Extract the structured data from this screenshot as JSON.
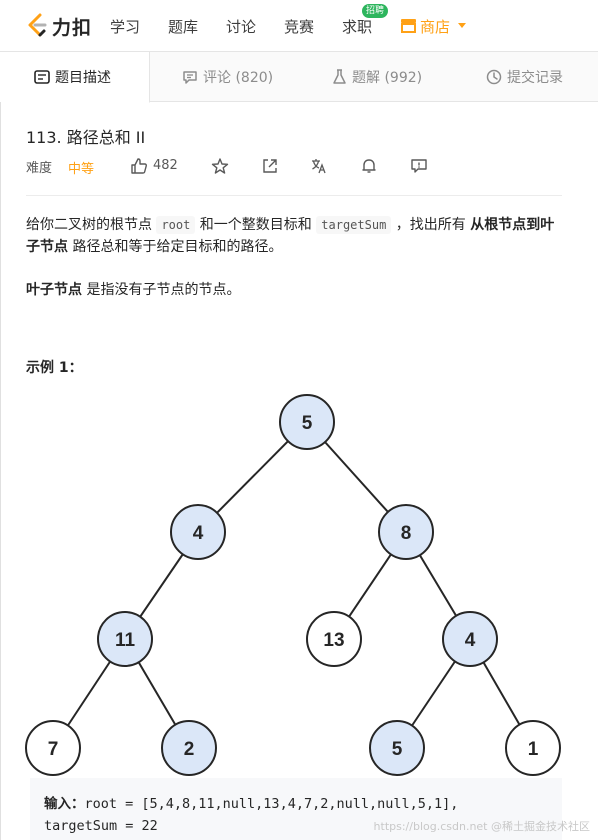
{
  "header": {
    "logo_text": "力扣",
    "nav": [
      "学习",
      "题库",
      "讨论",
      "竞赛",
      "求职"
    ],
    "job_badge": "招聘",
    "shop": "商店"
  },
  "tabs": [
    {
      "label": "题目描述",
      "icon": "document-icon",
      "active": true
    },
    {
      "label": "评论 (820)",
      "icon": "comment-icon",
      "active": false
    },
    {
      "label": "题解 (992)",
      "icon": "flask-icon",
      "active": false
    },
    {
      "label": "提交记录",
      "icon": "clock-icon",
      "active": false
    }
  ],
  "problem": {
    "title": "113. 路径总和 II",
    "difficulty_label": "难度",
    "difficulty": "中等",
    "likes": "482"
  },
  "description": {
    "p1_a": "给你二叉树的根节点 ",
    "p1_code1": "root",
    "p1_b": " 和一个整数目标和 ",
    "p1_code2": "targetSum",
    "p1_c": " ，找出所有 ",
    "p1_bold": "从根节点到叶子节点",
    "p1_d": " 路径总和等于给定目标和的路径。",
    "p2_bold": "叶子节点",
    "p2_rest": " 是指没有子节点的节点。"
  },
  "example": {
    "title": "示例 1：",
    "tree_nodes": [
      {
        "label": "5",
        "highlight": true
      },
      {
        "label": "4",
        "highlight": true
      },
      {
        "label": "8",
        "highlight": true
      },
      {
        "label": "11",
        "highlight": true
      },
      {
        "label": "13",
        "highlight": false
      },
      {
        "label": "4",
        "highlight": true
      },
      {
        "label": "7",
        "highlight": false
      },
      {
        "label": "2",
        "highlight": true
      },
      {
        "label": "5",
        "highlight": true
      },
      {
        "label": "1",
        "highlight": false
      }
    ],
    "input_label": "输入：",
    "input_line1": "root = [5,4,8,11,null,13,4,7,2,null,null,5,1],",
    "input_line2": "targetSum = 22"
  },
  "watermark": "https://blog.csdn.net @稀土掘金技术社区",
  "colors": {
    "accent": "#ffa116",
    "node_highlight": "#dbe7f8",
    "badge": "#2db55d"
  }
}
